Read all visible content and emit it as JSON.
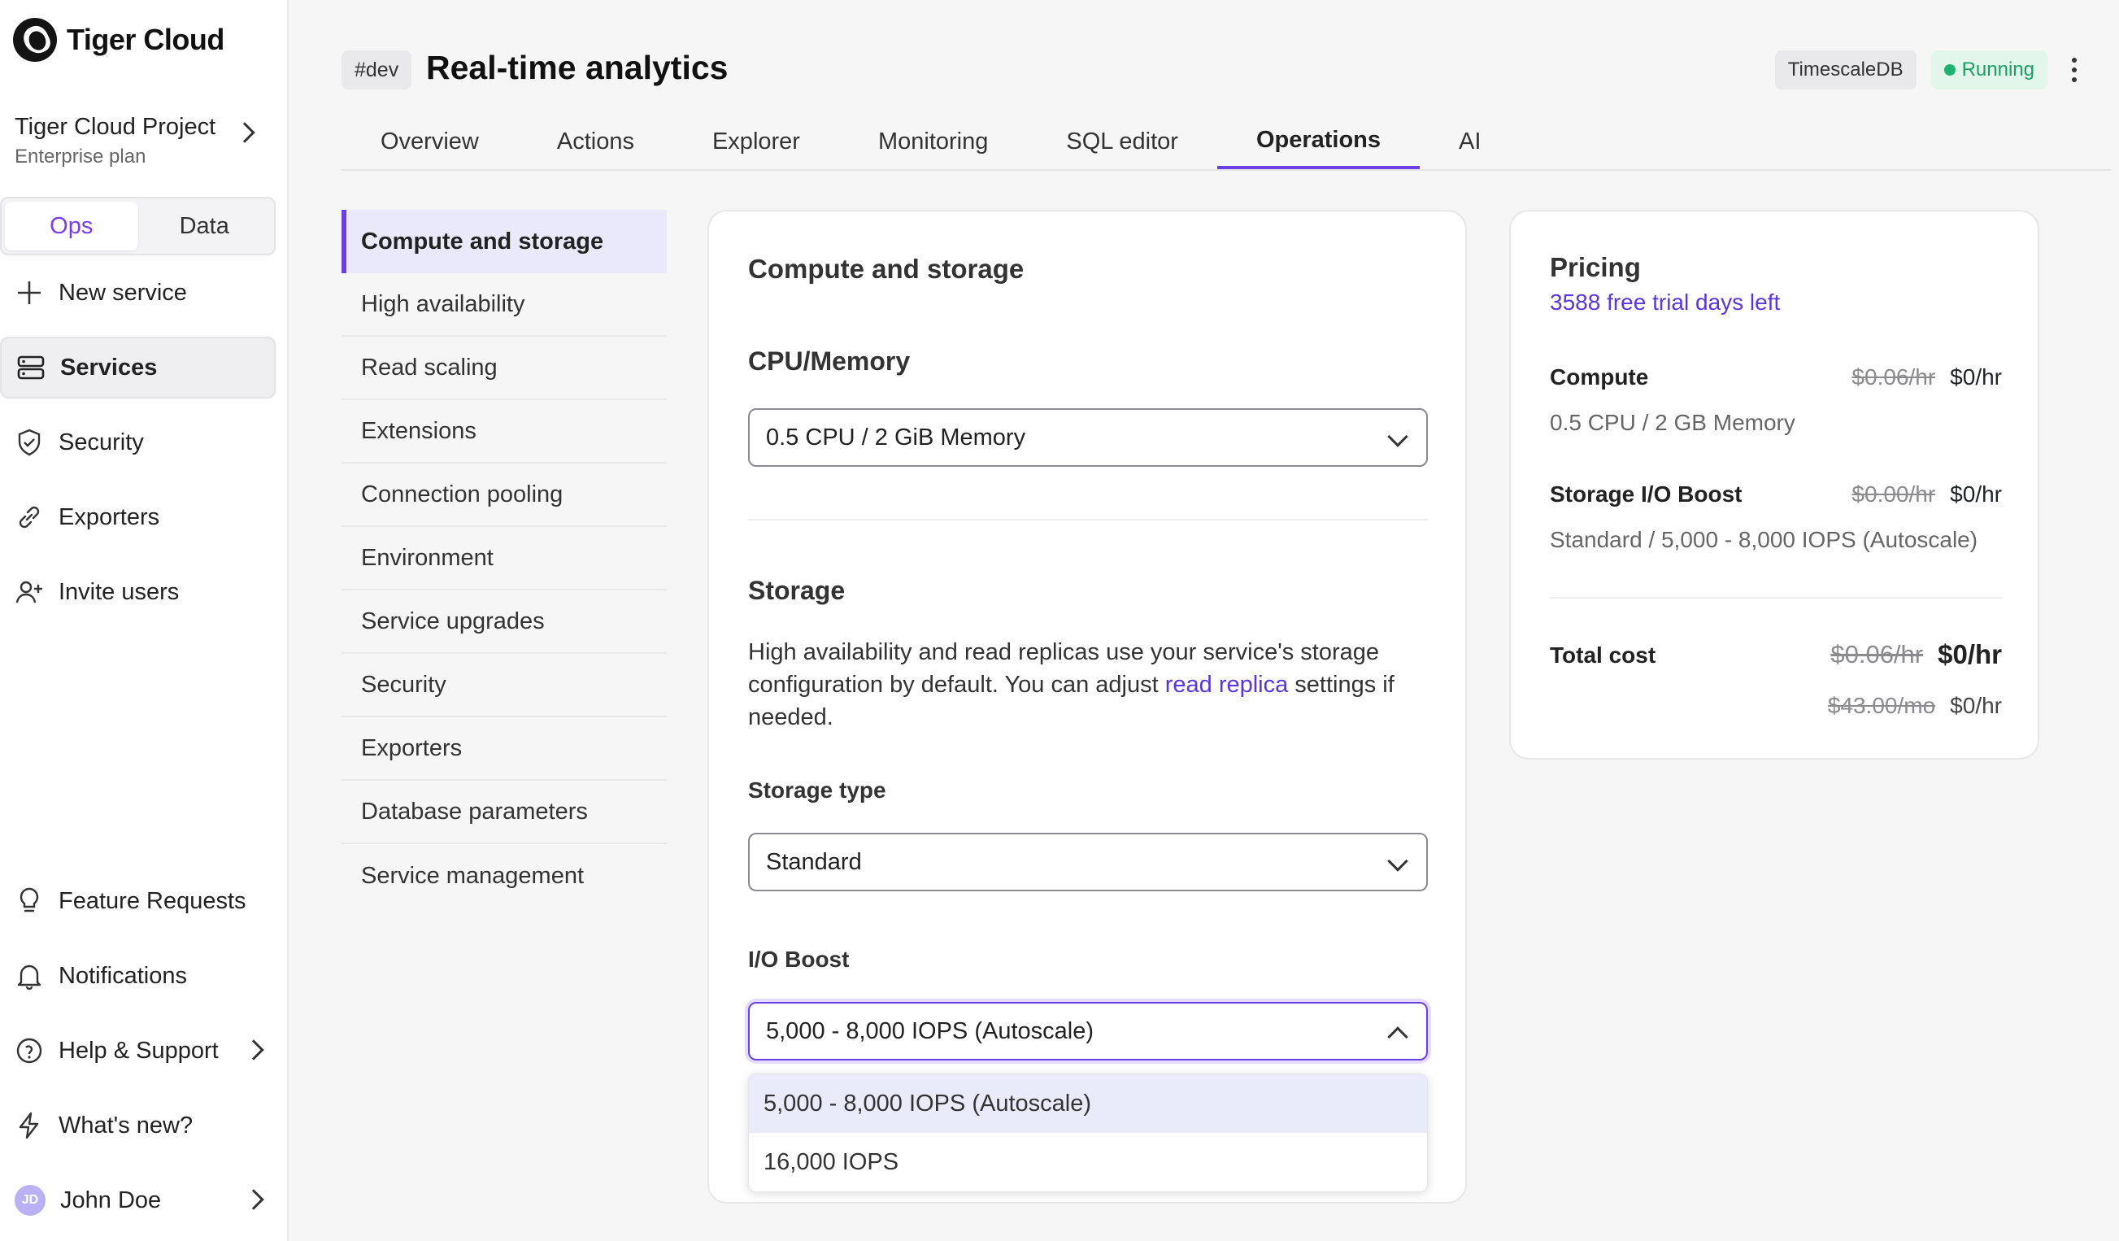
{
  "app": {
    "brand": "Tiger Cloud"
  },
  "sidebar": {
    "project_name": "Tiger Cloud Project",
    "project_plan": "Enterprise plan",
    "toggle": [
      "Ops",
      "Data"
    ],
    "items": [
      {
        "label": "New service",
        "icon": "plus-icon"
      },
      {
        "label": "Services",
        "icon": "server-icon"
      },
      {
        "label": "Security",
        "icon": "shield-check-icon"
      },
      {
        "label": "Exporters",
        "icon": "link-icon"
      },
      {
        "label": "Invite users",
        "icon": "user-plus-icon"
      }
    ],
    "bottom_items": [
      {
        "label": "Feature Requests",
        "icon": "lightbulb-icon"
      },
      {
        "label": "Notifications",
        "icon": "bell-icon"
      },
      {
        "label": "Help & Support",
        "icon": "help-circle-icon"
      },
      {
        "label": "What's new?",
        "icon": "lightning-icon"
      }
    ],
    "user": {
      "initials": "JD",
      "name": "John Doe"
    }
  },
  "header": {
    "env_tag": "#dev",
    "title": "Real-time analytics",
    "db_badge": "TimescaleDB",
    "status": "Running",
    "tabs": [
      "Overview",
      "Actions",
      "Explorer",
      "Monitoring",
      "SQL editor",
      "Operations",
      "AI"
    ]
  },
  "subnav": [
    "Compute and storage",
    "High availability",
    "Read scaling",
    "Extensions",
    "Connection pooling",
    "Environment",
    "Service upgrades",
    "Security",
    "Exporters",
    "Database parameters",
    "Service management"
  ],
  "main": {
    "title": "Compute and storage",
    "cpu_heading": "CPU/Memory",
    "cpu_value": "0.5 CPU / 2 GiB Memory",
    "storage_heading": "Storage",
    "storage_desc_1": "High availability and read replicas use your service's storage configuration by default. You can adjust ",
    "storage_desc_link": "read replica",
    "storage_desc_2": " settings if needed.",
    "storage_type_label": "Storage type",
    "storage_type_value": "Standard",
    "io_boost_label": "I/O Boost",
    "io_boost_value": "5,000 - 8,000 IOPS (Autoscale)",
    "io_boost_options": [
      "5,000 - 8,000 IOPS (Autoscale)",
      "16,000 IOPS"
    ]
  },
  "pricing": {
    "title": "Pricing",
    "trial": "3588 free trial days left",
    "compute_label": "Compute",
    "compute_old": "$0.06/hr",
    "compute_new": "$0/hr",
    "compute_desc": "0.5 CPU / 2 GB Memory",
    "storage_label": "Storage I/O Boost",
    "storage_old": "$0.00/hr",
    "storage_new": "$0/hr",
    "storage_desc": "Standard / 5,000 - 8,000 IOPS (Autoscale)",
    "total_label": "Total cost",
    "total_old": "$0.06/hr",
    "total_new": "$0/hr",
    "total_month_old": "$43.00/mo",
    "total_month_new": "$0/hr"
  },
  "colors": {
    "accent": "#6b3fe8",
    "link": "#5b35e0",
    "running": "#1aa063"
  }
}
